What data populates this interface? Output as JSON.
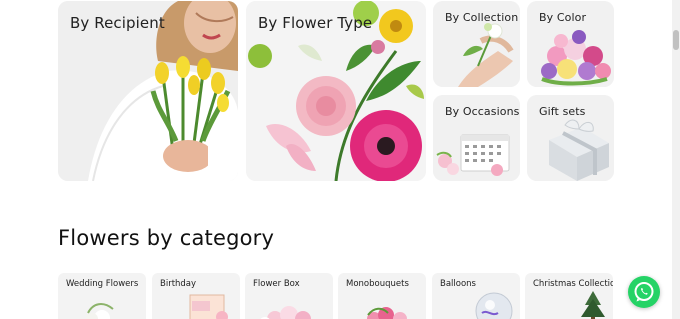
{
  "hero_tiles": [
    {
      "label": "By Recipient"
    },
    {
      "label": "By Flower Type"
    },
    {
      "label": "By Collection"
    },
    {
      "label": "By Color"
    },
    {
      "label": "By Occasions"
    },
    {
      "label": "Gift sets"
    }
  ],
  "section": {
    "title": "Flowers by category"
  },
  "categories": [
    {
      "label": "Wedding Flowers"
    },
    {
      "label": "Birthday"
    },
    {
      "label": "Flower Box"
    },
    {
      "label": "Monobouquets"
    },
    {
      "label": "Balloons"
    },
    {
      "label": "Christmas Collection"
    }
  ],
  "icons": {
    "whatsapp": "whatsapp-icon"
  },
  "colors": {
    "whatsapp": "#25d366",
    "tile_bg": "#f3f3f3"
  }
}
